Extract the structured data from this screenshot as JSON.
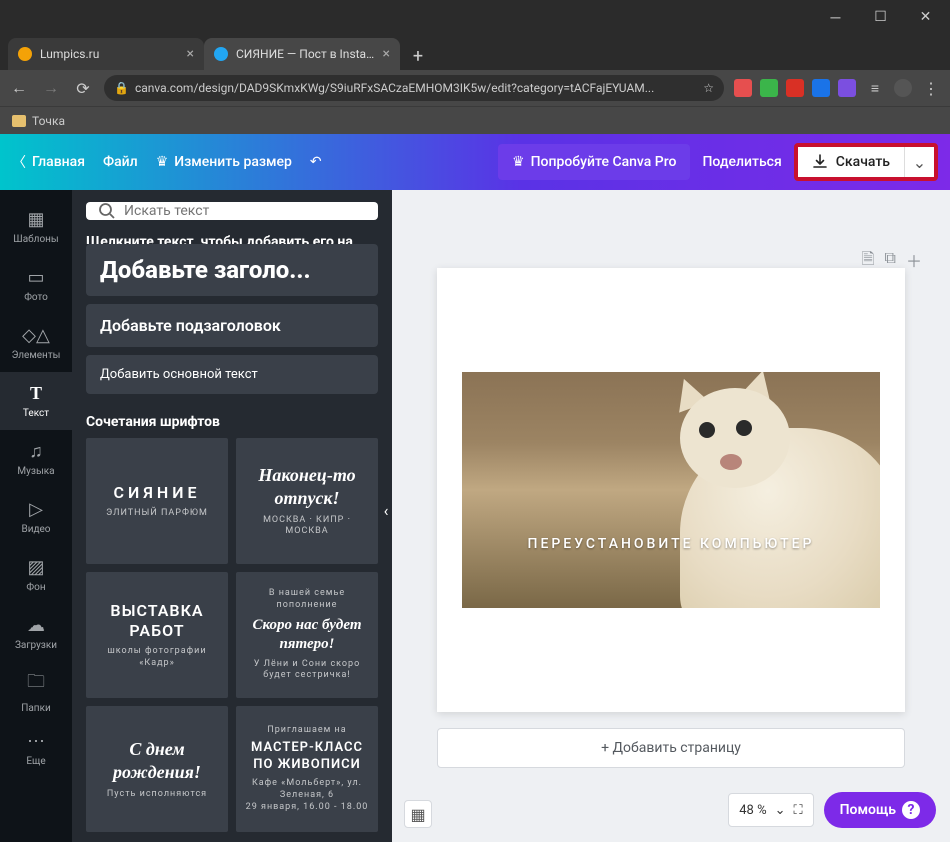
{
  "browser": {
    "tabs": [
      {
        "title": "Lumpics.ru",
        "favicon_color": "#f4a207"
      },
      {
        "title": "СИЯНИЕ — Пост в Instagram",
        "favicon_color": "#22a6f2"
      }
    ],
    "url": "canva.com/design/DAD9SKmxKWg/S9iuRFxSACzaEMHOM3IK5w/edit?category=tACFajEYUAM...",
    "bookmark_folder": "Точка"
  },
  "header": {
    "home": "Главная",
    "file": "Файл",
    "resize": "Изменить размер",
    "try_pro": "Попробуйте Canva Pro",
    "share": "Поделиться",
    "download": "Скачать"
  },
  "rail": {
    "items": [
      {
        "label": "Шаблоны",
        "icon": "layout"
      },
      {
        "label": "Фото",
        "icon": "photo"
      },
      {
        "label": "Элементы",
        "icon": "shapes"
      },
      {
        "label": "Текст",
        "icon": "text"
      },
      {
        "label": "Музыка",
        "icon": "music"
      },
      {
        "label": "Видео",
        "icon": "video"
      },
      {
        "label": "Фон",
        "icon": "background"
      },
      {
        "label": "Загрузки",
        "icon": "upload"
      },
      {
        "label": "Папки",
        "icon": "folder"
      },
      {
        "label": "Еще",
        "icon": "more"
      }
    ],
    "active_index": 3
  },
  "side": {
    "search_placeholder": "Искать текст",
    "hint": "Щелкните текст, чтобы добавить его на...",
    "add_heading": "Добавьте заголо...",
    "add_subheading": "Добавьте подзаголовок",
    "add_body": "Добавить основной текст",
    "combos_title": "Сочетания шрифтов",
    "cards": [
      {
        "title": "СИЯНИЕ",
        "sub": "ЭЛИТНЫЙ ПАРФЮМ",
        "style": "caps"
      },
      {
        "title": "Наконец-то отпуск!",
        "sub": "МОСКВА · КИПР · МОСКВА",
        "style": "script"
      },
      {
        "title": "ВЫСТАВКА РАБОТ",
        "sub": "школы фотографии «Кадр»",
        "style": "caps"
      },
      {
        "title": "Скоро нас будет пятеро!",
        "sub": "У Лёни и Сони скоро будет сестричка!",
        "pre": "В нашей семье пополнение",
        "style": "hand"
      },
      {
        "title": "С днем рождения!",
        "sub": "Пусть исполняются",
        "style": "script"
      },
      {
        "title": "МАСТЕР-КЛАСС ПО ЖИВОПИСИ",
        "sub": "Кафе «Мольберт», ул. Зеленая, 6\n29 января, 16.00 - 18.00",
        "pre": "Приглашаем на",
        "style": "caps"
      }
    ]
  },
  "canvas": {
    "meme_text": "ПЕРЕУСТАНОВИТЕ КОМПЬЮТЕР",
    "add_page": "+ Добавить страницу",
    "zoom": "48 %",
    "help": "Помощь"
  }
}
